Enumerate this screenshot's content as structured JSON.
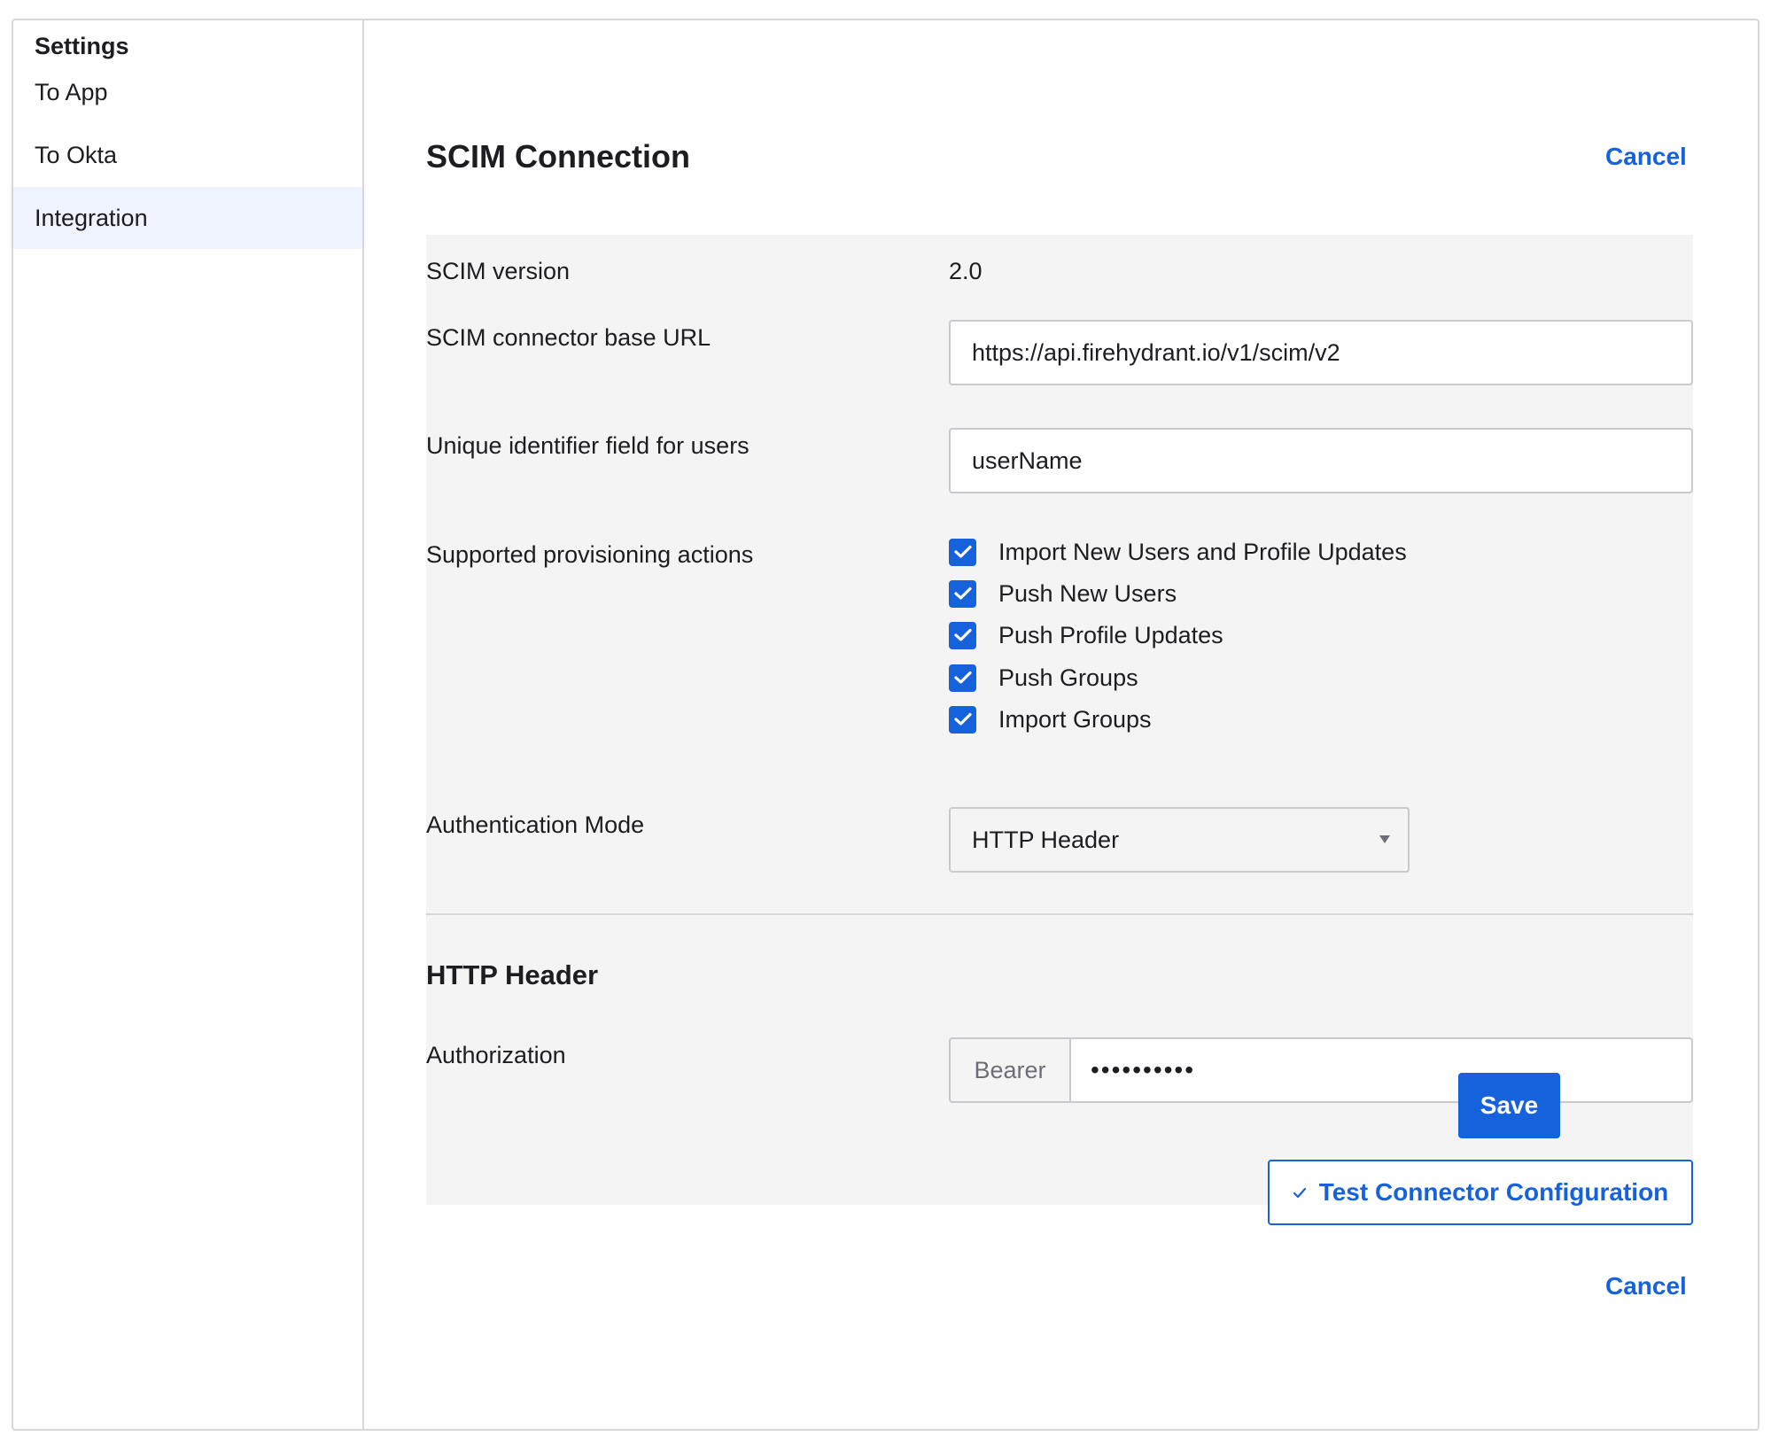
{
  "sidebar": {
    "heading": "Settings",
    "items": [
      {
        "label": "To App"
      },
      {
        "label": "To Okta"
      },
      {
        "label": "Integration"
      }
    ]
  },
  "header": {
    "title": "SCIM Connection",
    "cancel_label": "Cancel"
  },
  "form": {
    "scim_version_label": "SCIM version",
    "scim_version_value": "2.0",
    "base_url_label": "SCIM connector base URL",
    "base_url_value": "https://api.firehydrant.io/v1/scim/v2",
    "unique_id_label": "Unique identifier field for users",
    "unique_id_value": "userName",
    "actions_label": "Supported provisioning actions",
    "actions": [
      {
        "label": "Import New Users and Profile Updates",
        "checked": true
      },
      {
        "label": "Push New Users",
        "checked": true
      },
      {
        "label": "Push Profile Updates",
        "checked": true
      },
      {
        "label": "Push Groups",
        "checked": true
      },
      {
        "label": "Import Groups",
        "checked": true
      }
    ],
    "auth_mode_label": "Authentication Mode",
    "auth_mode_value": "HTTP Header"
  },
  "http_header": {
    "title": "HTTP Header",
    "authorization_label": "Authorization",
    "prefix": "Bearer",
    "token_masked": "••••••••••"
  },
  "buttons": {
    "test_label": "Test Connector Configuration",
    "save_label": "Save",
    "cancel_label": "Cancel"
  },
  "colors": {
    "accent": "#1662dd",
    "panel_bg": "#f4f4f4",
    "active_nav_bg": "#eff3fe"
  }
}
